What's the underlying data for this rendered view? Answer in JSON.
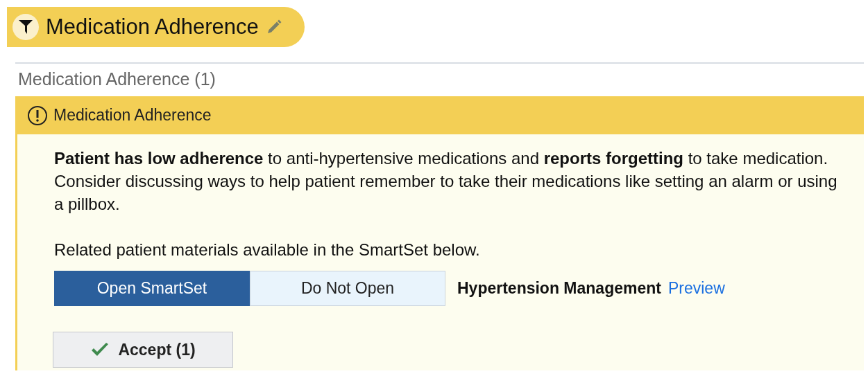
{
  "header": {
    "title": "Medication Adherence"
  },
  "section": {
    "title": "Medication Adherence (1)"
  },
  "alert": {
    "title": "Medication Adherence",
    "message": "**Patient has low adherence** to anti-hypertensive medications and **reports forgetting** to take medication. Consider discussing ways to help patient remember to take their medications like setting an alarm or using a pillbox.",
    "note": "Related patient materials available in the SmartSet below.",
    "choices": [
      {
        "label": "Open SmartSet",
        "selected": true
      },
      {
        "label": "Do Not Open",
        "selected": false
      }
    ],
    "smartset": {
      "name": "Hypertension Management",
      "link": "Preview"
    },
    "accept": {
      "label": "Accept (1)"
    }
  }
}
